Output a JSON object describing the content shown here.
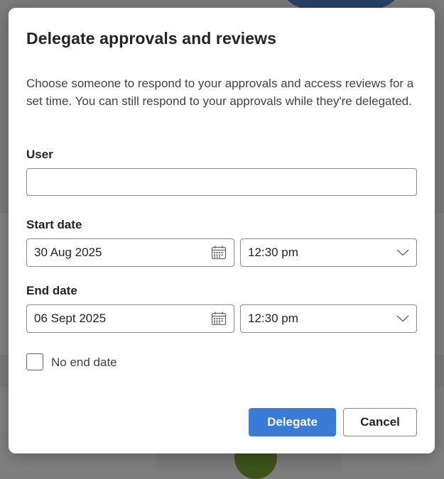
{
  "dialog": {
    "title": "Delegate approvals and reviews",
    "description": "Choose someone to respond to your approvals and access reviews for a set time. You can still respond to your approvals while they're delegated.",
    "user": {
      "label": "User",
      "value": "",
      "placeholder": ""
    },
    "start": {
      "label": "Start date",
      "date": "30 Aug 2025",
      "time": "12:30 pm"
    },
    "end": {
      "label": "End date",
      "date": "06 Sept 2025",
      "time": "12:30 pm"
    },
    "no_end_date": {
      "label": "No end date",
      "checked": false
    },
    "buttons": {
      "delegate": "Delegate",
      "cancel": "Cancel"
    }
  },
  "colors": {
    "primary": "#3b7bd8",
    "border": "#8a8a8a",
    "text": "#242424"
  },
  "icons": {
    "date": "calendar-icon",
    "time": "chevron-down-icon"
  }
}
